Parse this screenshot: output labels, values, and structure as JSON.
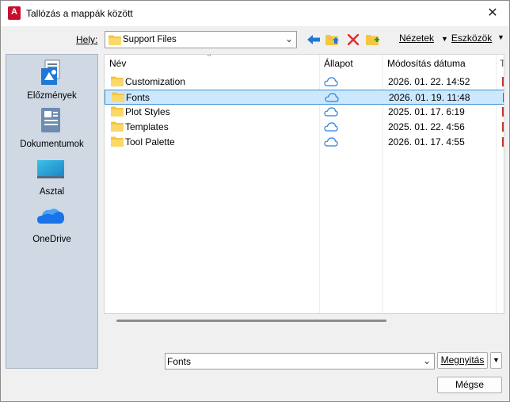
{
  "window": {
    "title": "Tallózás a mappák között",
    "app_icon_letter": "A",
    "close_glyph": "✕"
  },
  "toolbar": {
    "location_label": "Hely:",
    "location_value": "Support Files",
    "views_label": "Nézetek",
    "tools_label": "Eszközök"
  },
  "places": [
    {
      "label": "Előzmények",
      "icon": "history-icon"
    },
    {
      "label": "Dokumentumok",
      "icon": "documents-icon"
    },
    {
      "label": "Asztal",
      "icon": "desktop-icon"
    },
    {
      "label": "OneDrive",
      "icon": "onedrive-icon"
    }
  ],
  "file_list": {
    "columns": [
      "Név",
      "Állapot",
      "Módosítás dátuma"
    ],
    "rows": [
      {
        "name": "Customization",
        "date": "2026. 01. 22. 14:52",
        "selected": false
      },
      {
        "name": "Fonts",
        "date": "2026. 01. 19. 11:48",
        "selected": true
      },
      {
        "name": "Plot Styles",
        "date": "2025. 01. 17. 6:19",
        "selected": false
      },
      {
        "name": "Templates",
        "date": "2025. 01. 22. 4:56",
        "selected": false
      },
      {
        "name": "Tool Palette",
        "date": "2026. 01. 17. 4:55",
        "selected": false
      }
    ]
  },
  "footer": {
    "filename_value": "Fonts",
    "open_label": "Megnyitás",
    "cancel_label": "Mégse"
  },
  "colors": {
    "accent": "#1e78d6",
    "selection_bg": "#cce8ff",
    "places_bg": "#cfd8e3",
    "folder": "#f6c544"
  }
}
